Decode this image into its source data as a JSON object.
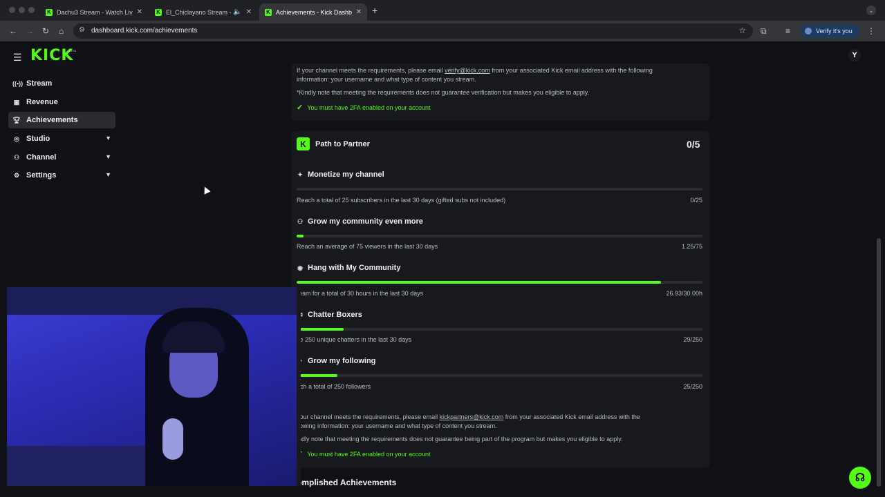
{
  "browser": {
    "tabs": [
      {
        "title": "Dachu3 Stream - Watch Live",
        "active": false
      },
      {
        "title": "El_Chiclayano Stream - W",
        "active": false
      },
      {
        "title": "Achievements - Kick Dashbo",
        "active": true
      }
    ],
    "url": "dashboard.kick.com/achievements",
    "verify_label": "Verify it's you"
  },
  "app": {
    "logo": "KICK",
    "logo_badge": "BETA",
    "avatar_initial": "Y",
    "accent": "#53fc18"
  },
  "sidebar": {
    "items": [
      {
        "label": "Stream",
        "icon": "broadcast-icon",
        "active": false,
        "expandable": false
      },
      {
        "label": "Revenue",
        "icon": "revenue-icon",
        "active": false,
        "expandable": false
      },
      {
        "label": "Achievements",
        "icon": "trophy-icon",
        "active": true,
        "expandable": false
      },
      {
        "label": "Studio",
        "icon": "studio-icon",
        "active": false,
        "expandable": true
      },
      {
        "label": "Channel",
        "icon": "channel-icon",
        "active": false,
        "expandable": true
      },
      {
        "label": "Settings",
        "icon": "gear-icon",
        "active": false,
        "expandable": true
      }
    ]
  },
  "verified_section": {
    "line1_pre": "If your channel meets the requirements, please email ",
    "line1_link": "verify@kick.com",
    "line1_post": " from your associated Kick email address with the following",
    "line2": "information: your username and what type of content you stream.",
    "note": "*Kindly note that meeting the requirements does not guarantee verification but makes you eligible to apply.",
    "requirement": "You must have 2FA enabled on your account"
  },
  "path_to_partner": {
    "title": "Path to Partner",
    "count": "0/5",
    "goals": [
      {
        "title": "Monetize my channel",
        "icon": "sparkle-icon",
        "desc": "Reach a total of 25 subscribers in the last 30 days (gifted subs not included)",
        "value": "0/25",
        "progress": 0.0
      },
      {
        "title": "Grow my community even more",
        "icon": "users-icon",
        "desc": "Reach an average of 75 viewers in the last 30 days",
        "value": "1.25/75",
        "progress": 0.017
      },
      {
        "title": "Hang with My Community",
        "icon": "broadcast-icon",
        "desc": "ream for a total of 30 hours in the last 30 days",
        "value": "26.93/30.00h",
        "progress": 0.898
      },
      {
        "title": "Chatter Boxers",
        "icon": "chat-icon",
        "desc": "ve 250 unique chatters in the last 30 days",
        "value": "29/250",
        "progress": 0.116
      },
      {
        "title": "Grow my following",
        "icon": "follow-icon",
        "desc": "ach a total of 250 followers",
        "value": "25/250",
        "progress": 0.1
      }
    ],
    "contact_line1_pre": "your channel meets the requirements, please email ",
    "contact_line1_link": "kickpartners@kick.com",
    "contact_line1_post": " from your associated Kick email address with the",
    "contact_line2": "llowing information: your username and what type of content you stream.",
    "contact_note": "indly note that meeting the requirements does not guarantee being part of the program but makes you eligible to apply.",
    "requirement": "You must have 2FA enabled on your account"
  },
  "accomplished_title": "omplished Achievements"
}
